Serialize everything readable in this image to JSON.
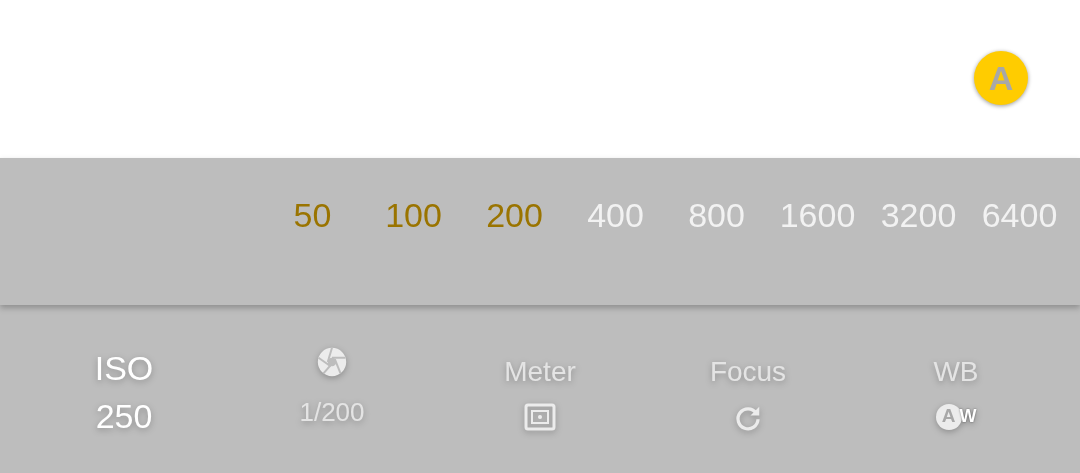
{
  "mode_badge": {
    "label": "A"
  },
  "iso_options": [
    {
      "label": "50",
      "highlighted": true
    },
    {
      "label": "100",
      "highlighted": true
    },
    {
      "label": "200",
      "highlighted": true
    },
    {
      "label": "400",
      "highlighted": false
    },
    {
      "label": "800",
      "highlighted": false
    },
    {
      "label": "1600",
      "highlighted": false
    },
    {
      "label": "3200",
      "highlighted": false
    },
    {
      "label": "6400",
      "highlighted": false
    }
  ],
  "controls": [
    {
      "kind": "iso",
      "label": "ISO",
      "value": "250"
    },
    {
      "kind": "shutter",
      "value": "1/200"
    },
    {
      "kind": "meter",
      "label": "Meter"
    },
    {
      "kind": "focus",
      "label": "Focus"
    },
    {
      "kind": "wb",
      "label": "WB",
      "icon_letter": "A",
      "icon_suffix": "W"
    }
  ]
}
